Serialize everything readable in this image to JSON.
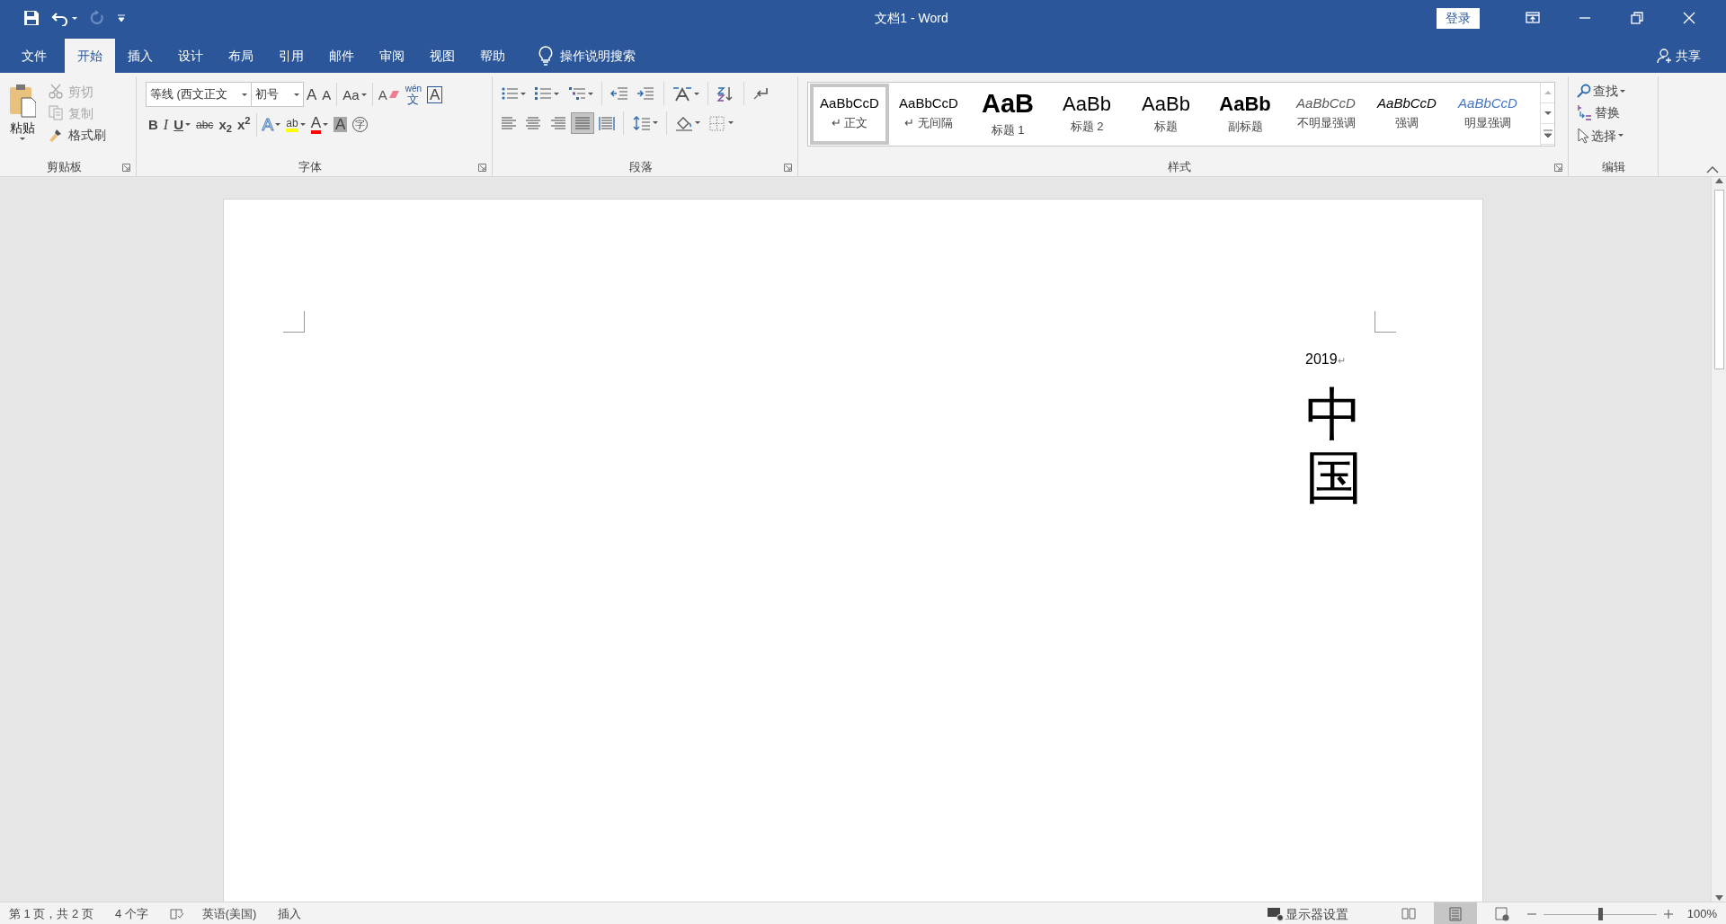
{
  "window": {
    "title": "文档1  -  Word",
    "sign_in": "登录"
  },
  "tabs": [
    {
      "label": "文件",
      "selected": false
    },
    {
      "label": "开始",
      "selected": true
    },
    {
      "label": "插入",
      "selected": false
    },
    {
      "label": "设计",
      "selected": false
    },
    {
      "label": "布局",
      "selected": false
    },
    {
      "label": "引用",
      "selected": false
    },
    {
      "label": "邮件",
      "selected": false
    },
    {
      "label": "审阅",
      "selected": false
    },
    {
      "label": "视图",
      "selected": false
    },
    {
      "label": "帮助",
      "selected": false
    }
  ],
  "tell_me": "操作说明搜索",
  "share": "共享",
  "clipboard": {
    "paste": "粘贴",
    "label": "剪贴板",
    "items": [
      {
        "label": "剪切",
        "disabled": true
      },
      {
        "label": "复制",
        "disabled": true
      },
      {
        "label": "格式刷",
        "disabled": false
      }
    ]
  },
  "font": {
    "font_name": "等线 (西文正文",
    "font_size": "初号",
    "label": "字体",
    "row1": [
      {
        "text": "A",
        "kind": "grow"
      },
      {
        "text": "A",
        "kind": "shrink"
      },
      {
        "text": "Aa",
        "kind": "case"
      },
      {
        "text": "A",
        "kind": "clear"
      },
      {
        "text": "wén",
        "kind": "phonetic_top"
      },
      {
        "text": "文",
        "kind": "phonetic"
      },
      {
        "text": "A",
        "kind": "border"
      }
    ],
    "row2": [
      {
        "text": "B",
        "kind": "bold"
      },
      {
        "text": "I",
        "kind": "italic"
      },
      {
        "text": "U",
        "kind": "underline"
      },
      {
        "text": "abc",
        "kind": "strike"
      },
      {
        "text": "x$_{2}$",
        "kind": "sub"
      },
      {
        "text": "x$^{2}$",
        "kind": "sup"
      },
      {
        "text": "A",
        "kind": "effects"
      },
      {
        "text": "ab",
        "kind": "highlight"
      },
      {
        "text": "A",
        "kind": "color"
      },
      {
        "text": "A",
        "kind": "shading"
      },
      {
        "text": "字",
        "kind": "enclose"
      }
    ]
  },
  "paragraph": {
    "label": "段落",
    "alignments": [
      {
        "selected": false
      },
      {
        "selected": false
      },
      {
        "selected": false
      },
      {
        "selected": true
      },
      {
        "selected": false
      }
    ]
  },
  "styles": {
    "label": "样式",
    "items": [
      {
        "preview": "AaBbCcD",
        "label": "↵ 正文",
        "kind": "normal",
        "selected": true
      },
      {
        "preview": "AaBbCcD",
        "label": "↵ 无间隔",
        "kind": "normal",
        "selected": false
      },
      {
        "preview": "AaB",
        "label": "标题 1",
        "kind": "heading1",
        "selected": false
      },
      {
        "preview": "AaBb",
        "label": "标题 2",
        "kind": "heading2",
        "selected": false
      },
      {
        "preview": "AaBb",
        "label": "标题",
        "kind": "title",
        "selected": false
      },
      {
        "preview": "AaBb",
        "label": "副标题",
        "kind": "subtitle",
        "selected": false
      },
      {
        "preview": "AaBbCcD",
        "label": "不明显强调",
        "kind": "subtle",
        "selected": false
      },
      {
        "preview": "AaBbCcD",
        "label": "强调",
        "kind": "emphasis",
        "selected": false
      },
      {
        "preview": "AaBbCcD",
        "label": "明显强调",
        "kind": "intense",
        "selected": false
      }
    ]
  },
  "editing": {
    "label": "编辑",
    "find": "查找",
    "replace": "替换",
    "select": "选择"
  },
  "document": {
    "line": "2019",
    "paragraph_mark": "↵",
    "vertical_text": "中国"
  },
  "status_bar": {
    "page": "第 1 页，共 2 页",
    "words": "4 个字",
    "language": "英语(美国)",
    "mode": "插入",
    "display_settings": "显示器设置",
    "views": [
      {
        "selected": false
      },
      {
        "selected": true
      },
      {
        "selected": false
      }
    ],
    "zoom_slider": {
      "level": 0.5
    },
    "zoom": "100%"
  }
}
